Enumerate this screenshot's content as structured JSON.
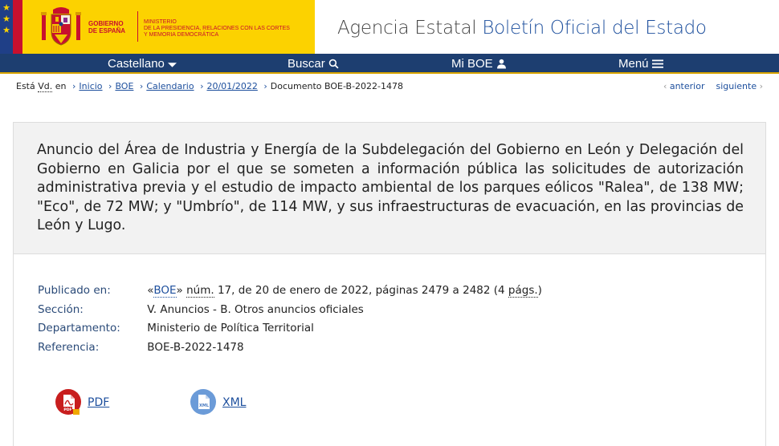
{
  "header": {
    "gov_label_line1": "GOBIERNO",
    "gov_label_line2": "DE ESPAÑA",
    "ministry_line1": "MINISTERIO",
    "ministry_line2": "DE LA PRESIDENCIA, RELACIONES CON LAS CORTES",
    "ministry_line3": "Y MEMORIA DEMOCRÁTICA",
    "agency_prefix": "Agencia Estatal",
    "agency_name": "Boletín Oficial del Estado",
    "colors": {
      "gov_yellow": "#fcd200",
      "gov_red": "#c8102e",
      "brand_blue": "#1d4f9d",
      "nav_blue": "#1d3e70",
      "nav_accent": "#d8a400"
    }
  },
  "nav": {
    "language": "Castellano",
    "search": "Buscar",
    "my_boe": "Mi BOE",
    "menu": "Menú",
    "icons": {
      "language": "caret-down-icon",
      "search": "search-icon",
      "my_boe": "user-icon",
      "menu": "hamburger-icon"
    }
  },
  "breadcrumb": {
    "prefix_1": "Está",
    "prefix_abbr": "Vd.",
    "prefix_2": "en",
    "items": [
      {
        "label": "Inicio"
      },
      {
        "label": "BOE"
      },
      {
        "label": "Calendario"
      },
      {
        "label": "20/01/2022"
      }
    ],
    "current": "Documento BOE-B-2022-1478",
    "prev": "anterior",
    "next": "siguiente"
  },
  "document": {
    "title": "Anuncio del Área de Industria y Energía de la Subdelegación del Gobierno en León y Delegación del Gobierno en Galicia por el que se someten a información pública las solicitudes de autorización administrativa previa y el estudio de impacto ambiental de los parques eólicos \"Ralea\", de 138 MW; \"Eco\", de 72 MW; y \"Umbrío\", de 114 MW, y sus infraestructuras de evacuación, en las provincias de León y Lugo.",
    "meta": {
      "published_label": "Publicado en:",
      "published_open": "«",
      "published_boe": "BOE",
      "published_close": "»",
      "published_num_abbr": "núm.",
      "published_rest": "17, de 20 de enero de 2022, páginas 2479 a 2482 (4",
      "published_pags_abbr": "págs.",
      "published_end": ")",
      "section_label": "Sección:",
      "section_value": "V. Anuncios - B. Otros anuncios oficiales",
      "department_label": "Departamento:",
      "department_value": "Ministerio de Política Territorial",
      "reference_label": "Referencia:",
      "reference_value": "BOE-B-2022-1478"
    },
    "downloads": [
      {
        "label": "PDF",
        "icon": "pdf-icon",
        "icon_text": "PDF"
      },
      {
        "label": "XML",
        "icon": "xml-icon",
        "icon_text": "XML"
      }
    ]
  }
}
